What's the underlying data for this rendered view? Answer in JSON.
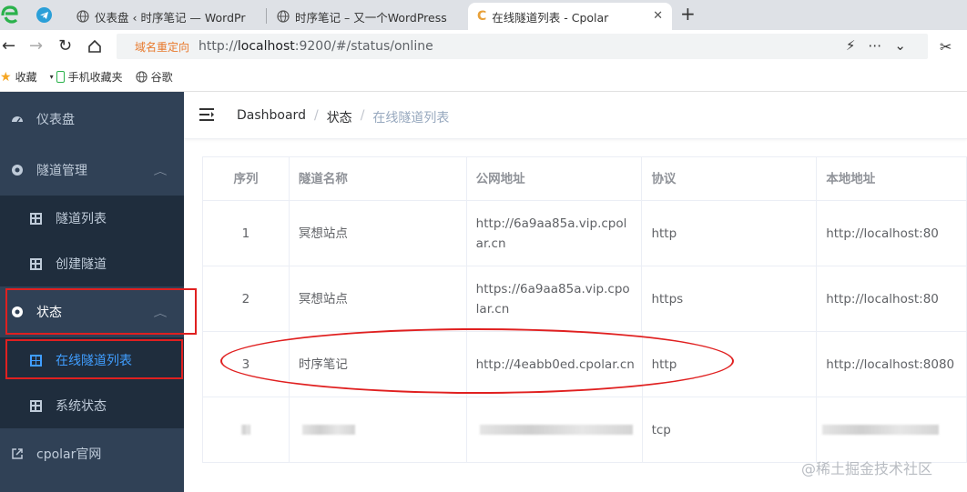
{
  "browser": {
    "tabs": [
      {
        "title": "仪表盘 ‹ 时序笔记 — WordPr"
      },
      {
        "title": "时序笔记 – 又一个WordPress"
      },
      {
        "title": "在线隧道列表 - Cpolar",
        "logo": "C"
      }
    ],
    "new_tab": "+",
    "close": "✕",
    "redirect_label": "域名重定向",
    "url_prefix": "http://",
    "url_host": "localhost",
    "url_rest": ":9200/#/status/online",
    "bookmarks": [
      {
        "label": "收藏",
        "icon": "star-icon"
      },
      {
        "label": "手机收藏夹",
        "icon": "phone-icon"
      },
      {
        "label": "谷歌",
        "icon": "globe-icon"
      }
    ]
  },
  "sidebar": {
    "dashboard": "仪表盘",
    "tunnel_mgmt": "隧道管理",
    "tunnel_list": "隧道列表",
    "create_tunnel": "创建隧道",
    "status": "状态",
    "online_list": "在线隧道列表",
    "system_status": "系统状态",
    "cpolar_site": "cpolar官网"
  },
  "breadcrumb": {
    "root": "Dashboard",
    "sep": "/",
    "level2": "状态",
    "current": "在线隧道列表"
  },
  "table": {
    "headers": [
      "序列",
      "隧道名称",
      "公网地址",
      "协议",
      "本地地址"
    ],
    "rows": [
      {
        "idx": "1",
        "name": "冥想站点",
        "public": "http://6a9aa85a.vip.cpolar.cn",
        "proto": "http",
        "local": "http://localhost:80"
      },
      {
        "idx": "2",
        "name": "冥想站点",
        "public": "https://6a9aa85a.vip.cpolar.cn",
        "proto": "https",
        "local": "http://localhost:80"
      },
      {
        "idx": "3",
        "name": "时序笔记",
        "public": "http://4eabb0ed.cpolar.cn",
        "proto": "http",
        "local": "http://localhost:8080"
      },
      {
        "idx": "",
        "name": "",
        "public": "",
        "proto": "tcp",
        "local": ""
      }
    ]
  },
  "watermark": "@稀土掘金技术社区",
  "colors": {
    "sidebar_bg": "#304156",
    "submenu_bg": "#1f2d3d",
    "active": "#409eff",
    "annotation": "#e02020"
  }
}
